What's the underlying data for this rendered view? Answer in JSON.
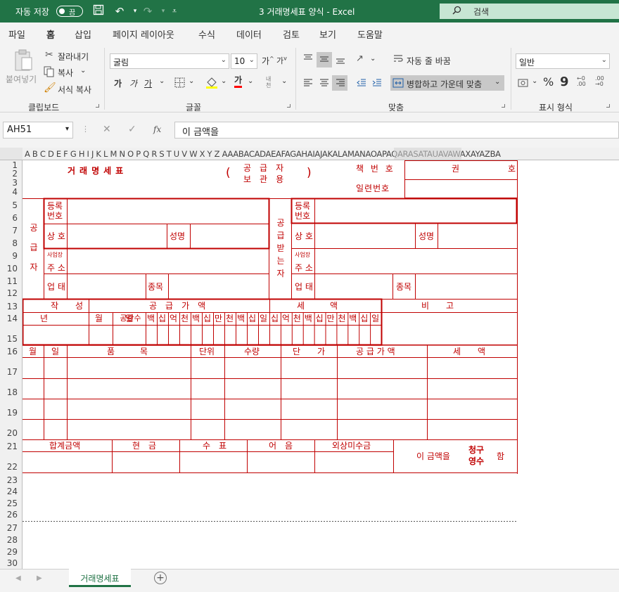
{
  "titlebar": {
    "autosave": "자동 저장",
    "toggle": "끔",
    "title": "3 거래명세표 양식  -  Excel",
    "search": "검색"
  },
  "tabs": [
    "파일",
    "홈",
    "삽입",
    "페이지 레이아웃",
    "수식",
    "데이터",
    "검토",
    "보기",
    "도움말"
  ],
  "ribbon": {
    "paste": "붙여넣기",
    "cut": "잘라내기",
    "copy": "복사",
    "format_painter": "서식 복사",
    "clipboard": "클립보드",
    "font_name": "굴림",
    "font_size": "10",
    "grow": "가",
    "shrink": "가",
    "bold": "가",
    "italic": "가",
    "underline": "가",
    "font_color": "가",
    "phonetic": "내천",
    "font_group": "글꼴",
    "wrap": "자동 줄 바꿈",
    "merge": "병합하고 가운데 맞춤",
    "align_group": "맞춤",
    "number_format": "일반",
    "percent": "%",
    "number_group": "표시 형식"
  },
  "formula": {
    "namebox": "AH51",
    "fx": "fx",
    "value": "이 금액을"
  },
  "columns": "A B C D E F G H I J K L M N O P Q R S T U V W X Y Z AAABACADAEAFAGAHAIAJAKALAMANAOAPAQARASATAUAVAWAXAYAZBA",
  "rows": [
    "1",
    "2",
    "3",
    "4",
    "5",
    "6",
    "7",
    "8",
    "9",
    "10",
    "11",
    "12",
    "13",
    "14",
    "15",
    "16",
    "17",
    "18",
    "19",
    "20",
    "21",
    "22",
    "23",
    "24",
    "25",
    "26",
    "27",
    "28",
    "29",
    "30"
  ],
  "form": {
    "title": "거래명세표",
    "copy_type_top": "공　급　자",
    "copy_type_bottom": "보　관　용",
    "paren_open": "(",
    "paren_close": ")",
    "book_no": "책 번 호",
    "kwon": "권",
    "ho": "호",
    "serial_no": "일련번호",
    "supplier_v": "공급자",
    "receiver_v": "공급받는자",
    "reg_no": "등록번호",
    "company": "상 호",
    "name": "성명",
    "office_small": "사업장",
    "address": "주 소",
    "biz_type": "업 태",
    "biz_item": "종목",
    "written": "작　　성",
    "supply_value": "공　급　가　액",
    "tax": "세　　　액",
    "note": "비　　고",
    "year": "년",
    "month": "월",
    "day": "일",
    "blank_count": "공란수",
    "digits_supply": [
      "백",
      "십",
      "억",
      "천",
      "백",
      "십",
      "만",
      "천",
      "백",
      "십",
      "일"
    ],
    "digits_tax": [
      "십",
      "억",
      "천",
      "백",
      "십",
      "만",
      "천",
      "백",
      "십",
      "일"
    ],
    "item_month": "월",
    "item_day": "일",
    "item_name": "품　　　목",
    "unit": "단위",
    "qty": "수량",
    "price": "단　　가",
    "supply_amount": "공 급 가 액",
    "tax_amount": "세　　액",
    "total": "합계금액",
    "cash": "현　금",
    "check": "수　표",
    "note_bill": "어　음",
    "credit": "외상미수금",
    "this_amount": "이 금액을",
    "claim": "청구",
    "receipt": "영수",
    "ham": "함"
  },
  "sheet_tab": "거래명세표"
}
